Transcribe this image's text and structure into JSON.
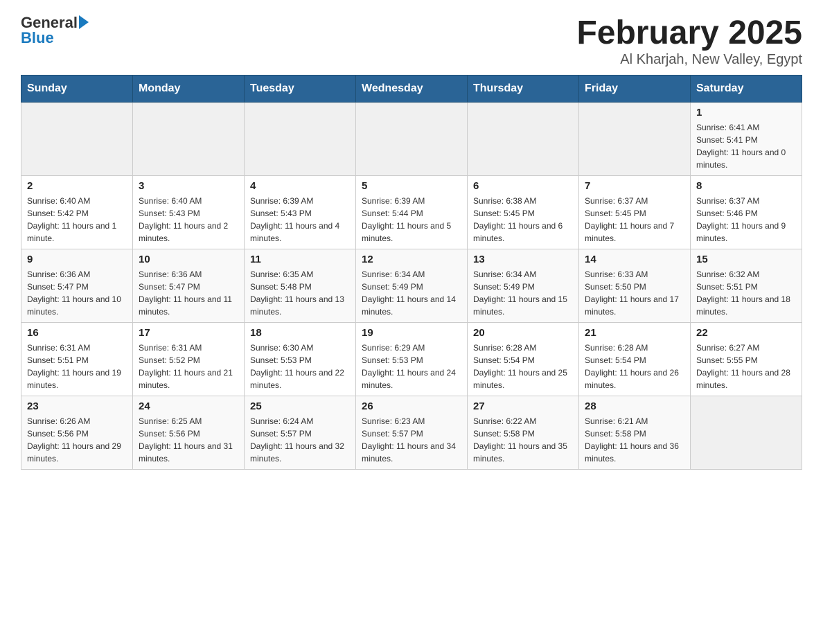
{
  "header": {
    "logo": {
      "general": "General",
      "arrow": "▶",
      "blue": "Blue"
    },
    "title": "February 2025",
    "subtitle": "Al Kharjah, New Valley, Egypt"
  },
  "days_of_week": [
    "Sunday",
    "Monday",
    "Tuesday",
    "Wednesday",
    "Thursday",
    "Friday",
    "Saturday"
  ],
  "weeks": [
    [
      {
        "day": "",
        "info": ""
      },
      {
        "day": "",
        "info": ""
      },
      {
        "day": "",
        "info": ""
      },
      {
        "day": "",
        "info": ""
      },
      {
        "day": "",
        "info": ""
      },
      {
        "day": "",
        "info": ""
      },
      {
        "day": "1",
        "info": "Sunrise: 6:41 AM\nSunset: 5:41 PM\nDaylight: 11 hours and 0 minutes."
      }
    ],
    [
      {
        "day": "2",
        "info": "Sunrise: 6:40 AM\nSunset: 5:42 PM\nDaylight: 11 hours and 1 minute."
      },
      {
        "day": "3",
        "info": "Sunrise: 6:40 AM\nSunset: 5:43 PM\nDaylight: 11 hours and 2 minutes."
      },
      {
        "day": "4",
        "info": "Sunrise: 6:39 AM\nSunset: 5:43 PM\nDaylight: 11 hours and 4 minutes."
      },
      {
        "day": "5",
        "info": "Sunrise: 6:39 AM\nSunset: 5:44 PM\nDaylight: 11 hours and 5 minutes."
      },
      {
        "day": "6",
        "info": "Sunrise: 6:38 AM\nSunset: 5:45 PM\nDaylight: 11 hours and 6 minutes."
      },
      {
        "day": "7",
        "info": "Sunrise: 6:37 AM\nSunset: 5:45 PM\nDaylight: 11 hours and 7 minutes."
      },
      {
        "day": "8",
        "info": "Sunrise: 6:37 AM\nSunset: 5:46 PM\nDaylight: 11 hours and 9 minutes."
      }
    ],
    [
      {
        "day": "9",
        "info": "Sunrise: 6:36 AM\nSunset: 5:47 PM\nDaylight: 11 hours and 10 minutes."
      },
      {
        "day": "10",
        "info": "Sunrise: 6:36 AM\nSunset: 5:47 PM\nDaylight: 11 hours and 11 minutes."
      },
      {
        "day": "11",
        "info": "Sunrise: 6:35 AM\nSunset: 5:48 PM\nDaylight: 11 hours and 13 minutes."
      },
      {
        "day": "12",
        "info": "Sunrise: 6:34 AM\nSunset: 5:49 PM\nDaylight: 11 hours and 14 minutes."
      },
      {
        "day": "13",
        "info": "Sunrise: 6:34 AM\nSunset: 5:49 PM\nDaylight: 11 hours and 15 minutes."
      },
      {
        "day": "14",
        "info": "Sunrise: 6:33 AM\nSunset: 5:50 PM\nDaylight: 11 hours and 17 minutes."
      },
      {
        "day": "15",
        "info": "Sunrise: 6:32 AM\nSunset: 5:51 PM\nDaylight: 11 hours and 18 minutes."
      }
    ],
    [
      {
        "day": "16",
        "info": "Sunrise: 6:31 AM\nSunset: 5:51 PM\nDaylight: 11 hours and 19 minutes."
      },
      {
        "day": "17",
        "info": "Sunrise: 6:31 AM\nSunset: 5:52 PM\nDaylight: 11 hours and 21 minutes."
      },
      {
        "day": "18",
        "info": "Sunrise: 6:30 AM\nSunset: 5:53 PM\nDaylight: 11 hours and 22 minutes."
      },
      {
        "day": "19",
        "info": "Sunrise: 6:29 AM\nSunset: 5:53 PM\nDaylight: 11 hours and 24 minutes."
      },
      {
        "day": "20",
        "info": "Sunrise: 6:28 AM\nSunset: 5:54 PM\nDaylight: 11 hours and 25 minutes."
      },
      {
        "day": "21",
        "info": "Sunrise: 6:28 AM\nSunset: 5:54 PM\nDaylight: 11 hours and 26 minutes."
      },
      {
        "day": "22",
        "info": "Sunrise: 6:27 AM\nSunset: 5:55 PM\nDaylight: 11 hours and 28 minutes."
      }
    ],
    [
      {
        "day": "23",
        "info": "Sunrise: 6:26 AM\nSunset: 5:56 PM\nDaylight: 11 hours and 29 minutes."
      },
      {
        "day": "24",
        "info": "Sunrise: 6:25 AM\nSunset: 5:56 PM\nDaylight: 11 hours and 31 minutes."
      },
      {
        "day": "25",
        "info": "Sunrise: 6:24 AM\nSunset: 5:57 PM\nDaylight: 11 hours and 32 minutes."
      },
      {
        "day": "26",
        "info": "Sunrise: 6:23 AM\nSunset: 5:57 PM\nDaylight: 11 hours and 34 minutes."
      },
      {
        "day": "27",
        "info": "Sunrise: 6:22 AM\nSunset: 5:58 PM\nDaylight: 11 hours and 35 minutes."
      },
      {
        "day": "28",
        "info": "Sunrise: 6:21 AM\nSunset: 5:58 PM\nDaylight: 11 hours and 36 minutes."
      },
      {
        "day": "",
        "info": ""
      }
    ]
  ]
}
